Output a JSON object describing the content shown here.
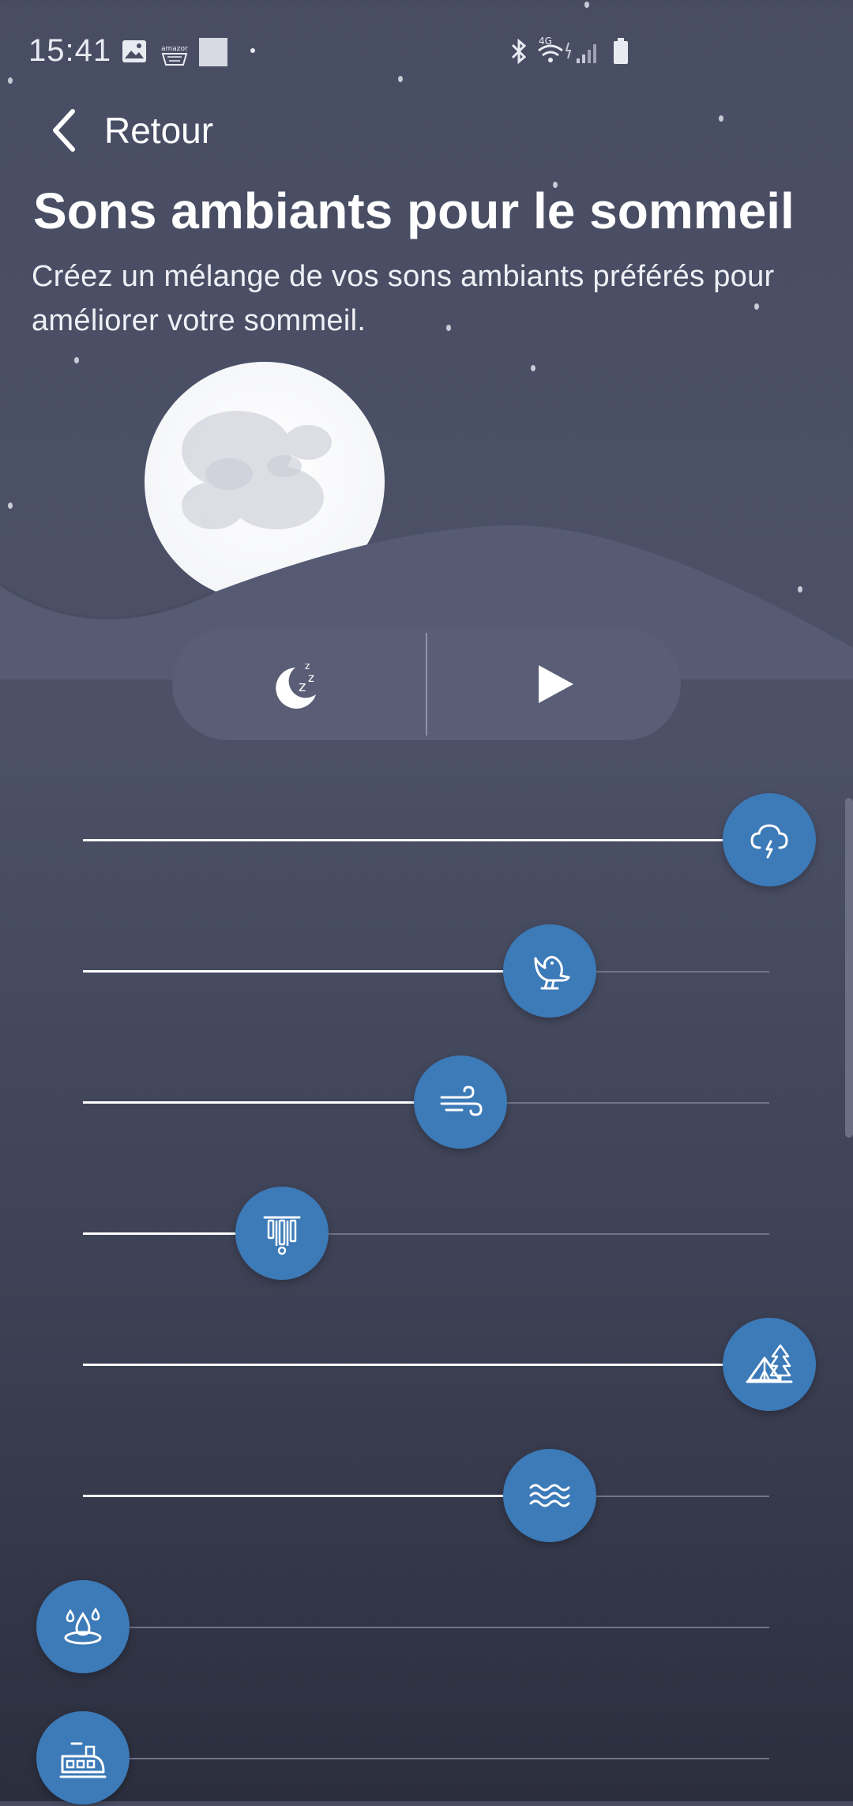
{
  "status_bar": {
    "time": "15:41",
    "network": "4G",
    "icons": [
      "image-icon",
      "amazon-icon",
      "square-icon",
      "dot-icon",
      "bluetooth-icon",
      "wifi-icon",
      "signal-icon",
      "battery-icon"
    ]
  },
  "header": {
    "back_label": "Retour",
    "title": "Sons ambiants pour le sommeil",
    "subtitle": "Créez un mélange de vos sons ambiants préférés pour améliorer votre sommeil."
  },
  "controls": {
    "timer_icon": "sleep-timer-icon",
    "play_icon": "play-icon"
  },
  "colors": {
    "knob": "#3c7ab8",
    "background_top": "#484d63",
    "background_bottom": "#2b2e3d"
  },
  "sounds": [
    {
      "name": "thunderstorm",
      "icon": "thunderstorm-icon",
      "level": 1.0
    },
    {
      "name": "bird",
      "icon": "bird-icon",
      "level": 0.68
    },
    {
      "name": "wind",
      "icon": "wind-icon",
      "level": 0.55
    },
    {
      "name": "wind-chimes",
      "icon": "wind-chimes-icon",
      "level": 0.29
    },
    {
      "name": "camping",
      "icon": "tent-forest-icon",
      "level": 1.0
    },
    {
      "name": "waves",
      "icon": "waves-icon",
      "level": 0.68
    },
    {
      "name": "water-drops",
      "icon": "water-drop-icon",
      "level": 0.0
    },
    {
      "name": "train",
      "icon": "train-icon",
      "level": 0.0
    }
  ]
}
